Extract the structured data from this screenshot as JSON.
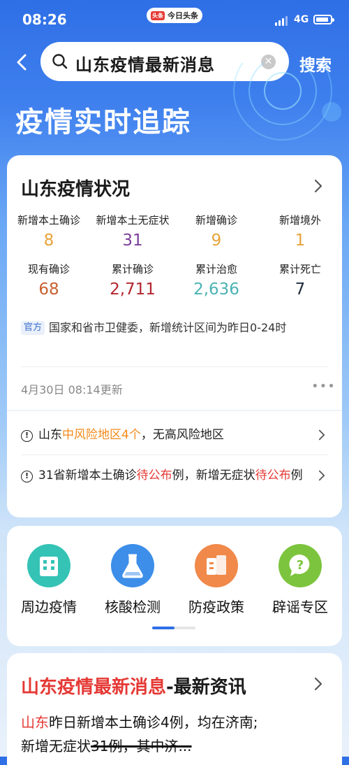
{
  "status_bar": {
    "time": "08:26",
    "app_logo": "头条",
    "app_name": "今日头条",
    "network": "4G"
  },
  "search": {
    "query": "山东疫情最新消息",
    "button_label": "搜索"
  },
  "banner": {
    "title": "疫情实时追踪"
  },
  "overview": {
    "title": "山东疫情状况",
    "stats": [
      {
        "label": "新增本土确诊",
        "value": "8",
        "color": "#e8a33a"
      },
      {
        "label": "新增本土无症状",
        "value": "31",
        "color": "#7b3f99"
      },
      {
        "label": "新增确诊",
        "value": "9",
        "color": "#e8a33a"
      },
      {
        "label": "新增境外",
        "value": "1",
        "color": "#e8a33a"
      },
      {
        "label": "现有确诊",
        "value": "68",
        "color": "#c8602f"
      },
      {
        "label": "累计确诊",
        "value": "2,711",
        "color": "#b3262d"
      },
      {
        "label": "累计治愈",
        "value": "2,636",
        "color": "#4bb3b3"
      },
      {
        "label": "累计死亡",
        "value": "7",
        "color": "#1f2d3d"
      }
    ],
    "source_tag": "官方",
    "source_text": "国家和省市卫健委，新增统计区间为昨日0-24时",
    "updated": "4月30日 08:14更新",
    "more": "•••"
  },
  "notices": [
    {
      "prefix": "山东",
      "highlight": "中风险地区4个",
      "suffix": "，无高风险地区"
    },
    {
      "p1": "31省新增本土确诊",
      "r1": "待公布",
      "p2": "例，新增无症状",
      "r2": "待公布",
      "p3": "例"
    }
  ],
  "services": [
    {
      "label": "周边疫情",
      "icon": "building-icon",
      "color": "#34c3b5"
    },
    {
      "label": "核酸检测",
      "icon": "flask-icon",
      "color": "#3d8ee9"
    },
    {
      "label": "防疫政策",
      "icon": "policy-icon",
      "color": "#f0894a"
    },
    {
      "label": "辟谣专区",
      "icon": "question-icon",
      "color": "#7cc43d"
    }
  ],
  "news": {
    "title_highlight": "山东疫情最新消息",
    "title_rest": "-最新资讯",
    "line1_red": "山东",
    "line1": "昨日新增本土确诊4例，均在济南;",
    "line2": "新增无症状",
    "line2_strike": "31例，其中济...",
    "colors": {
      "accent": "#e53935",
      "blue": "#2f6fe6"
    }
  }
}
